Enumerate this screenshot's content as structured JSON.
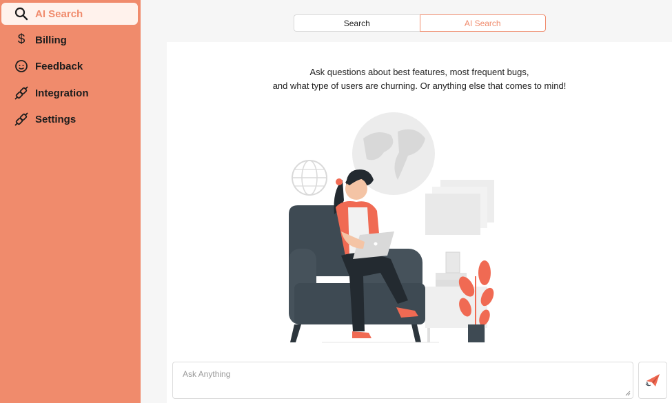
{
  "sidebar": {
    "items": [
      {
        "label": "AI Search",
        "icon": "search-icon",
        "active": true
      },
      {
        "label": "Billing",
        "icon": "dollar-icon"
      },
      {
        "label": "Feedback",
        "icon": "smiley-icon"
      },
      {
        "label": "Integration",
        "icon": "plug-icon"
      },
      {
        "label": "Settings",
        "icon": "plug-icon"
      }
    ]
  },
  "tabs": [
    {
      "label": "Search"
    },
    {
      "label": "AI Search",
      "active": true
    }
  ],
  "main": {
    "intro_line1": "Ask questions about best features, most frequent bugs,",
    "intro_line2": "and what type of users are churning. Or anything else that comes to mind!",
    "input_placeholder": "Ask Anything",
    "send_icon": "paper-plane-icon"
  },
  "colors": {
    "accent": "#f08b6c",
    "active_bg": "#fff2ec",
    "chair": "#3e4a53"
  }
}
